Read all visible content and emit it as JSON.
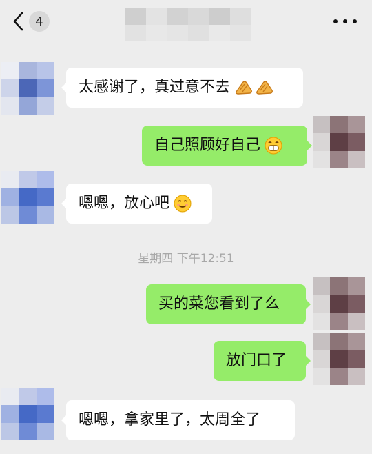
{
  "header": {
    "unread_count": "4",
    "back_icon": "chevron-left-icon",
    "more_icon": "more-dots-icon"
  },
  "messages": [
    {
      "from": "contact",
      "text": "太感谢了，真过意不去",
      "emojis": [
        "bread-icon",
        "bread-icon"
      ]
    },
    {
      "from": "me",
      "text": "自己照顾好自己",
      "emojis": [
        "grin-emoji"
      ]
    },
    {
      "from": "contact",
      "text": "嗯嗯，放心吧",
      "emojis": [
        "smile-emoji"
      ]
    },
    {
      "from": "me",
      "text": "买的菜您看到了么",
      "emojis": []
    },
    {
      "from": "me",
      "text": "放门口了",
      "emojis": []
    },
    {
      "from": "contact",
      "text": "嗯嗯，拿家里了，太周全了",
      "emojis": []
    }
  ],
  "timestamp": "星期四 下午12:51",
  "colors": {
    "background": "#ededed",
    "incoming_bubble": "#ffffff",
    "outgoing_bubble": "#95ec69",
    "timestamp_text": "#a8a8a8"
  }
}
